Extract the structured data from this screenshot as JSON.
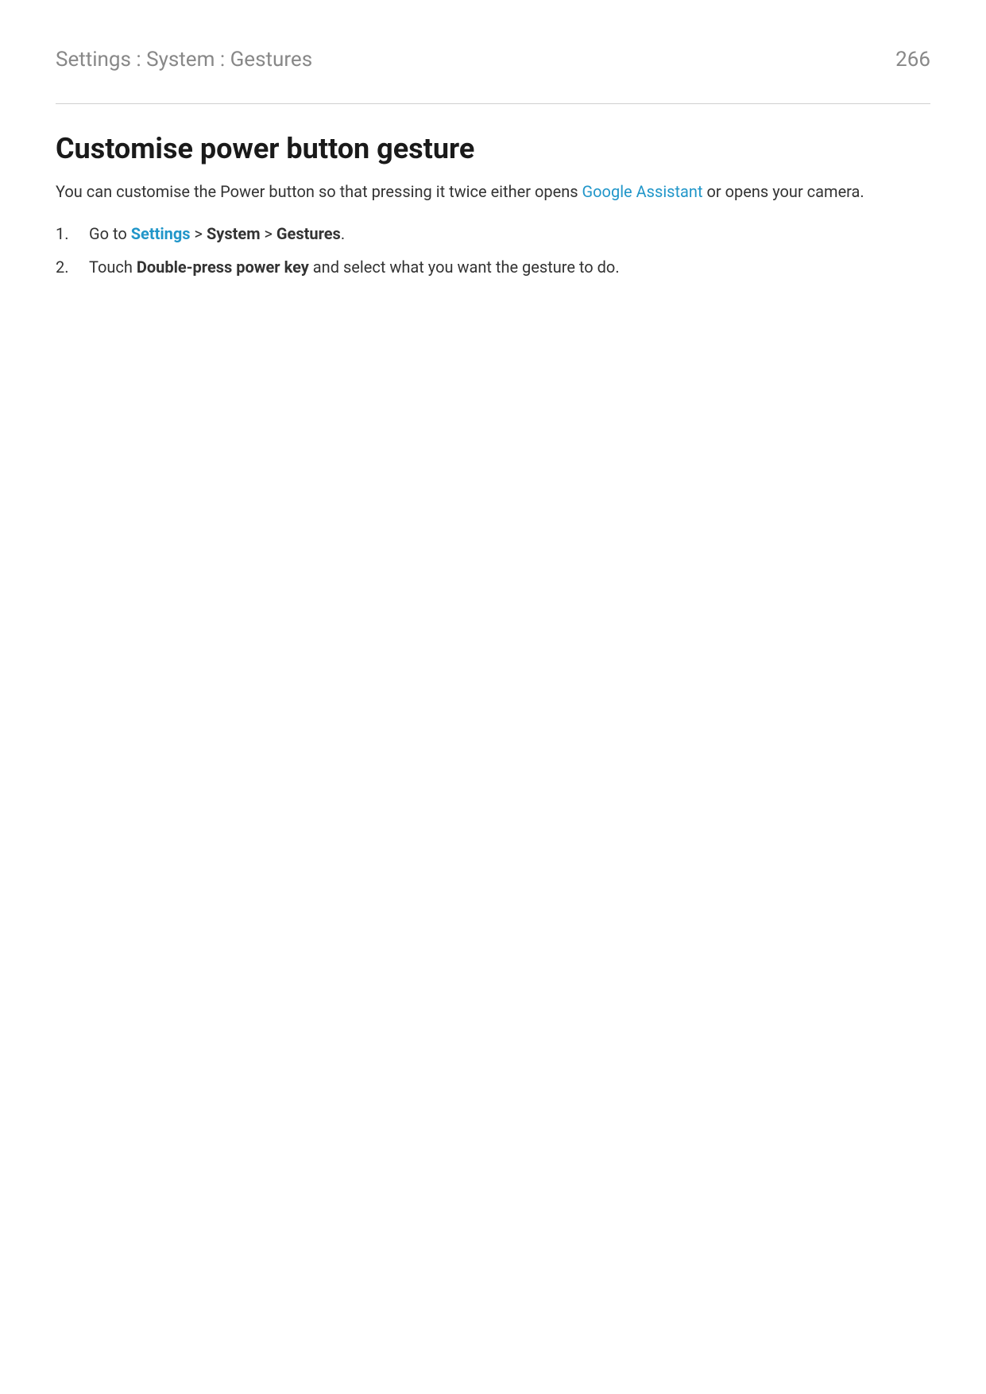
{
  "header": {
    "breadcrumb": "Settings : System : Gestures",
    "page_number": "266"
  },
  "title": "Customise power button gesture",
  "intro": {
    "part1": "You can customise the Power button so that pressing it twice either opens ",
    "link": "Google Assistant",
    "part2": " or opens your camera."
  },
  "steps": {
    "step1": {
      "prefix": "Go to ",
      "settings_link": "Settings",
      "sep1": " > ",
      "system": "System",
      "sep2": " > ",
      "gestures": "Gestures",
      "suffix": "."
    },
    "step2": {
      "prefix": "Touch ",
      "bold": "Double-press power key",
      "suffix": " and select what you want the gesture to do."
    }
  }
}
